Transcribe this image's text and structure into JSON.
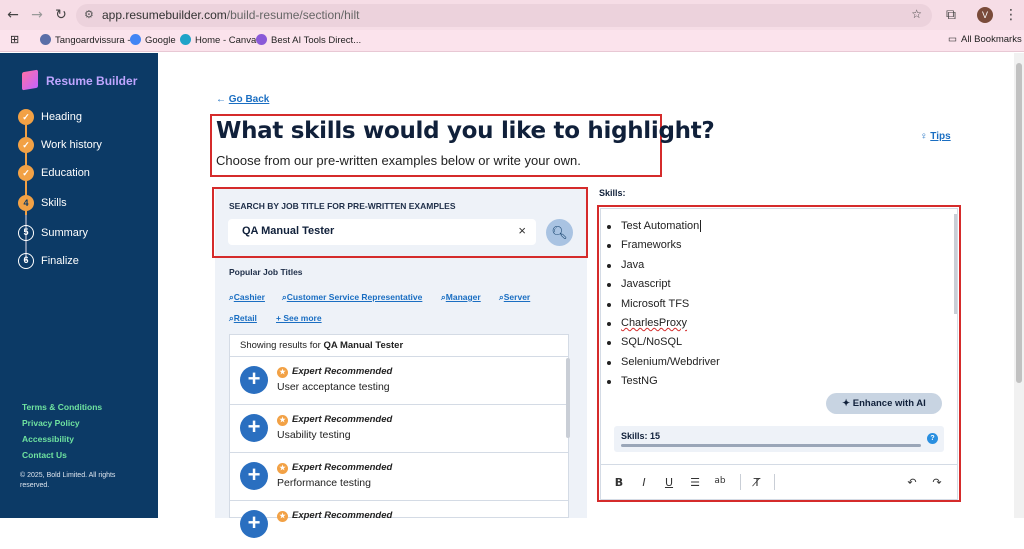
{
  "browser": {
    "url_host": "app.resumebuilder.com",
    "url_path": "/build-resume/section/hilt",
    "profile_initial": "V",
    "bookmarks": [
      "Tangoardvissura -",
      "Google",
      "Home - Canva",
      "Best AI Tools Direct..."
    ],
    "all_bookmarks": "All Bookmarks"
  },
  "sidebar": {
    "brand": "Resume Builder",
    "steps": [
      {
        "label": "Heading",
        "marker": "✓"
      },
      {
        "label": "Work history",
        "marker": "✓"
      },
      {
        "label": "Education",
        "marker": "✓"
      },
      {
        "label": "Skills",
        "marker": "4"
      },
      {
        "label": "Summary",
        "marker": "5"
      },
      {
        "label": "Finalize",
        "marker": "6"
      }
    ],
    "footer_links": [
      "Terms & Conditions",
      "Privacy Policy",
      "Accessibility",
      "Contact Us"
    ],
    "copyright": "© 2025, Bold Limited. All rights reserved."
  },
  "main": {
    "go_back": "Go Back",
    "headline": "What skills would you like to highlight?",
    "subhead": "Choose from our pre-written examples below or write your own.",
    "tips": "Tips"
  },
  "search": {
    "label": "SEARCH BY JOB TITLE FOR PRE-WRITTEN EXAMPLES",
    "value": "QA Manual Tester",
    "popular_label": "Popular Job Titles",
    "popular_titles": [
      "Cashier",
      "Customer Service Representative",
      "Manager",
      "Server",
      "Retail"
    ],
    "see_more": "+ See more"
  },
  "results": {
    "showing_prefix": "Showing results for",
    "query": "QA Manual Tester",
    "items": [
      {
        "badge": "Expert Recommended",
        "text": "User acceptance testing"
      },
      {
        "badge": "Expert Recommended",
        "text": "Usability testing"
      },
      {
        "badge": "Expert Recommended",
        "text": "Performance testing"
      },
      {
        "badge": "Expert Recommended",
        "text": ""
      }
    ]
  },
  "skills": {
    "label": "Skills:",
    "items": [
      "Test Automation",
      "Frameworks",
      "Java",
      "Javascript",
      "Microsoft TFS",
      "CharlesProxy",
      "SQL/NoSQL",
      "Selenium/Webdriver",
      "TestNG"
    ],
    "enhance_button": "Enhance with AI",
    "count_label": "Skills: 15"
  },
  "colors": {
    "sidebar_bg": "#0c3a66",
    "accent_orange": "#f2a145",
    "link_blue": "#1a6ec2",
    "highlight_red": "#d52b2b",
    "footer_green": "#6fe3a0"
  }
}
